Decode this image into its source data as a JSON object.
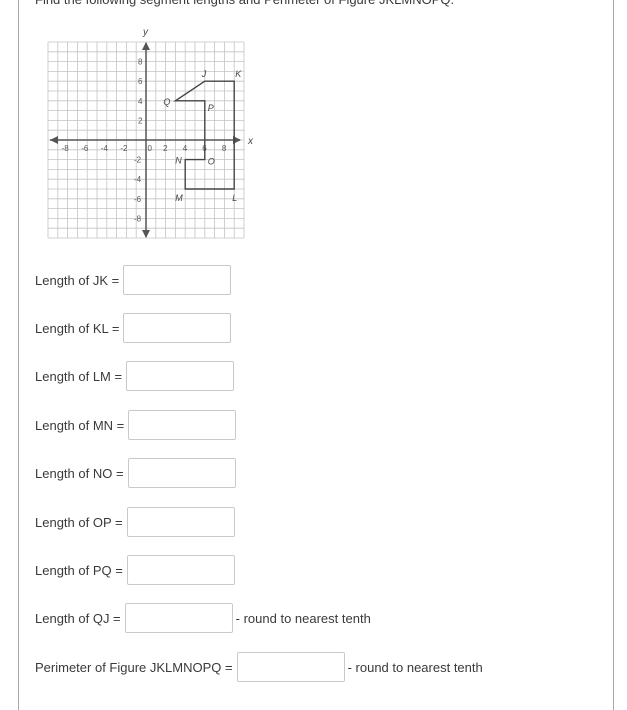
{
  "question": {
    "prompt": "Find the following segment lengths and Perimeter of Figure JKLMNOPQ."
  },
  "graph": {
    "x_axis_label": "x",
    "y_axis_label": "y",
    "x_tick_labels": [
      "-8",
      "-6",
      "-4",
      "-2",
      "0",
      "2",
      "4",
      "6",
      "8"
    ],
    "y_tick_labels": [
      "8",
      "6",
      "4",
      "2",
      "-2",
      "-4",
      "-6",
      "-8"
    ],
    "axis_range": [
      -10,
      10
    ],
    "points": [
      {
        "name": "J",
        "x": 6,
        "y": 6
      },
      {
        "name": "K",
        "x": 9,
        "y": 6
      },
      {
        "name": "L",
        "x": 9,
        "y": -5
      },
      {
        "name": "M",
        "x": 4,
        "y": -5
      },
      {
        "name": "N",
        "x": 4,
        "y": -2
      },
      {
        "name": "O",
        "x": 6,
        "y": -2
      },
      {
        "name": "P",
        "x": 6,
        "y": 4
      },
      {
        "name": "Q",
        "x": 3,
        "y": 4
      }
    ]
  },
  "fields": [
    {
      "label": "Length of JK =",
      "value": "",
      "hint": ""
    },
    {
      "label": "Length of KL =",
      "value": "",
      "hint": ""
    },
    {
      "label": "Length of LM =",
      "value": "",
      "hint": ""
    },
    {
      "label": "Length of MN =",
      "value": "",
      "hint": ""
    },
    {
      "label": "Length of NO =",
      "value": "",
      "hint": ""
    },
    {
      "label": "Length of OP =",
      "value": "",
      "hint": ""
    },
    {
      "label": "Length of PQ =",
      "value": "",
      "hint": ""
    },
    {
      "label": "Length of QJ =",
      "value": "",
      "hint": "- round to nearest tenth"
    },
    {
      "label": "Perimeter of Figure JKLMNOPQ =",
      "value": "",
      "hint": "- round to nearest tenth"
    }
  ]
}
